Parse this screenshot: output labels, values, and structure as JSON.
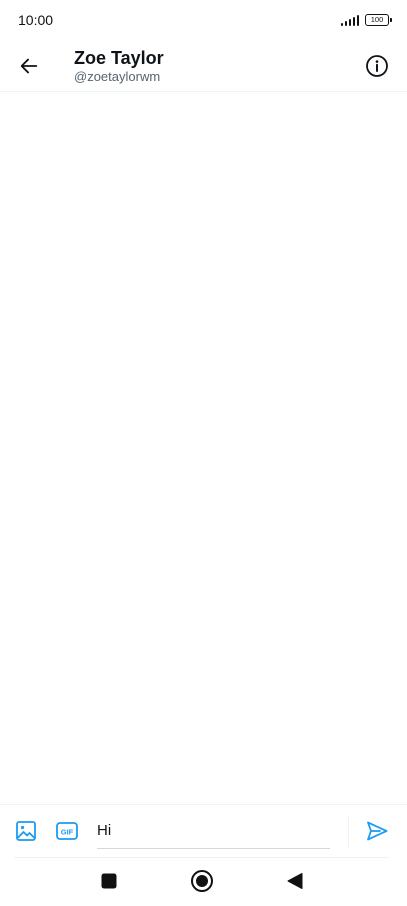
{
  "status_bar": {
    "time": "10:00",
    "battery": "100"
  },
  "header": {
    "name": "Zoe Taylor",
    "handle": "@zoetaylorwm",
    "back_icon": "arrow-left-icon",
    "info_icon": "info-icon"
  },
  "composer": {
    "input_value": "Hi",
    "image_icon": "image-icon",
    "gif_label": "GIF",
    "send_icon": "send-icon"
  },
  "colors": {
    "accent": "#1d9bf0",
    "text": "#0f1419",
    "secondary_text": "#536471",
    "divider": "#eff3f4"
  },
  "nav_bar": {
    "recent_icon": "square-icon",
    "home_icon": "circle-home-icon",
    "back_icon": "triangle-back-icon"
  }
}
